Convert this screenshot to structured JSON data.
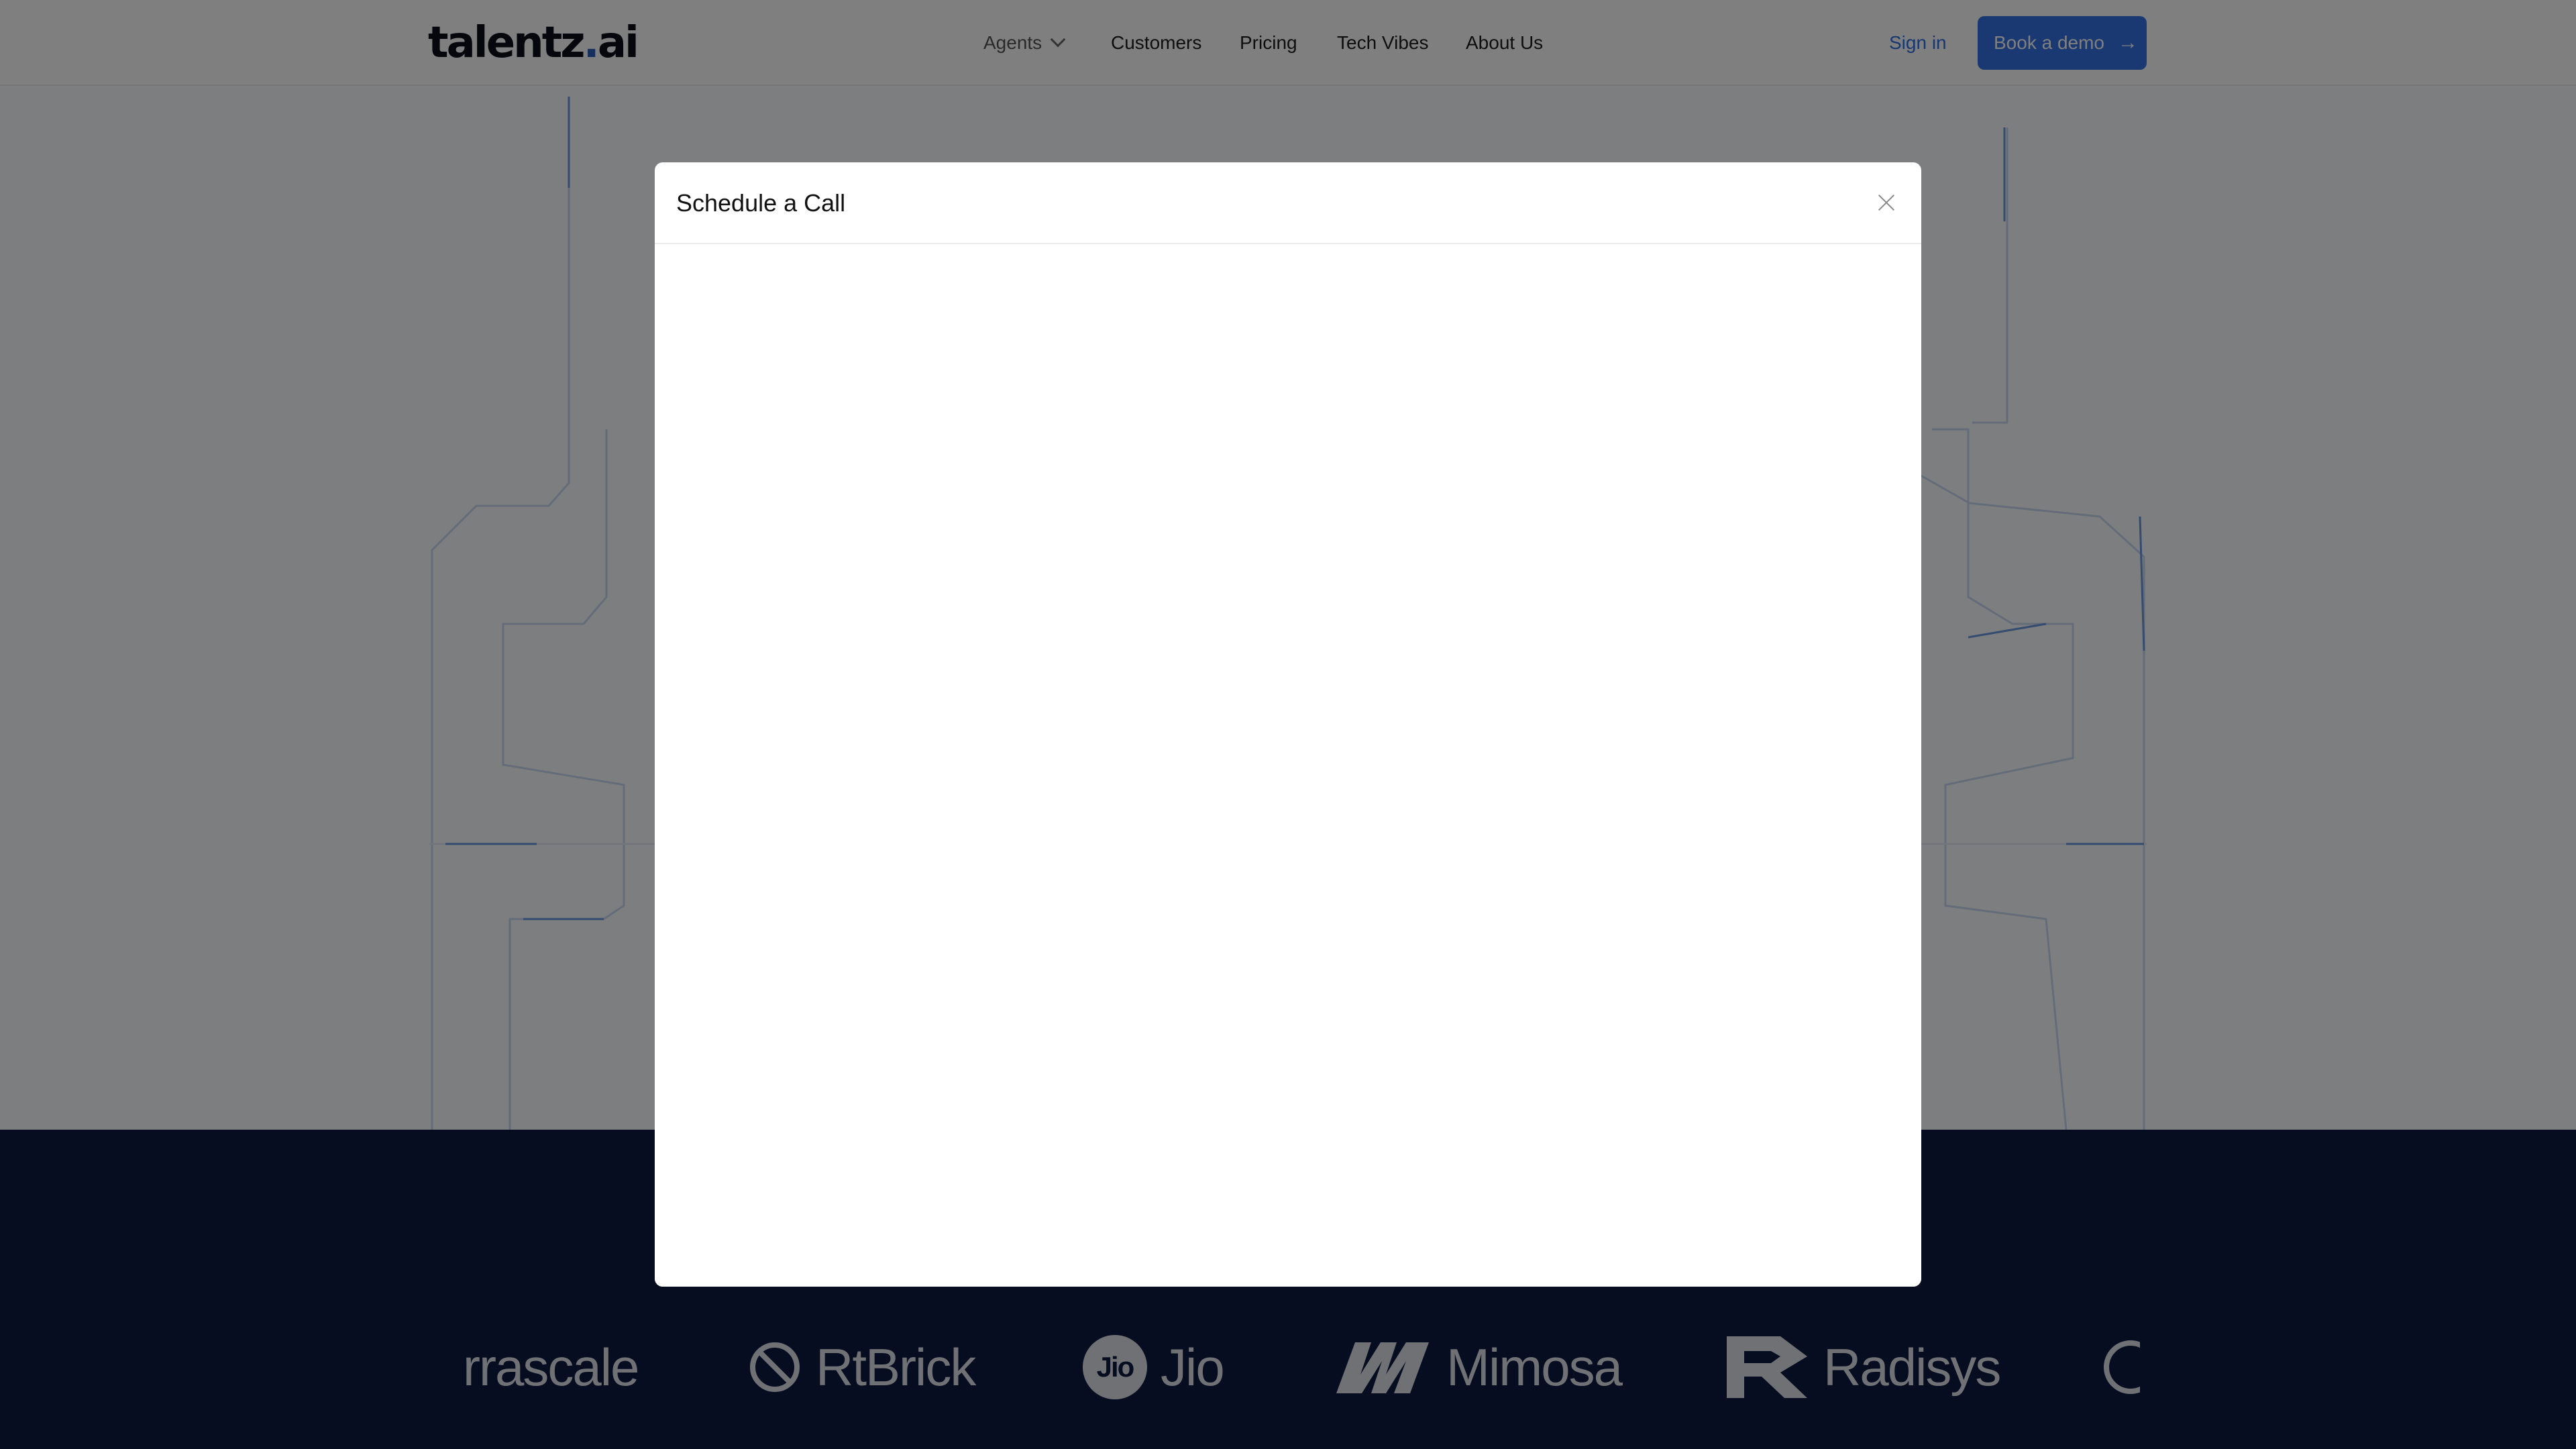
{
  "header": {
    "logo_main": "talentz",
    "logo_dot": ".",
    "logo_suffix": "ai",
    "nav": [
      {
        "label": "Agents"
      },
      {
        "label": "Customers"
      },
      {
        "label": "Pricing"
      },
      {
        "label": "Tech Vibes"
      },
      {
        "label": "About Us"
      }
    ],
    "sign_in": "Sign in",
    "book_demo": "Book a demo",
    "book_demo_icon": "arrow-right-icon"
  },
  "logos": [
    {
      "name": "rrascale"
    },
    {
      "name": "RtBrick",
      "icon": "rtbrick-icon"
    },
    {
      "name": "Jio",
      "icon": "jio-icon"
    },
    {
      "name": "Mimosa",
      "icon": "mimosa-icon"
    },
    {
      "name": "Radisys",
      "icon": "radisys-icon"
    }
  ],
  "modal": {
    "title": "Schedule a Call",
    "close_icon": "close-icon"
  },
  "colors": {
    "accent": "#3572e6",
    "dark_band": "#0d1a40",
    "overlay": "rgba(0,0,0,0.5)"
  }
}
